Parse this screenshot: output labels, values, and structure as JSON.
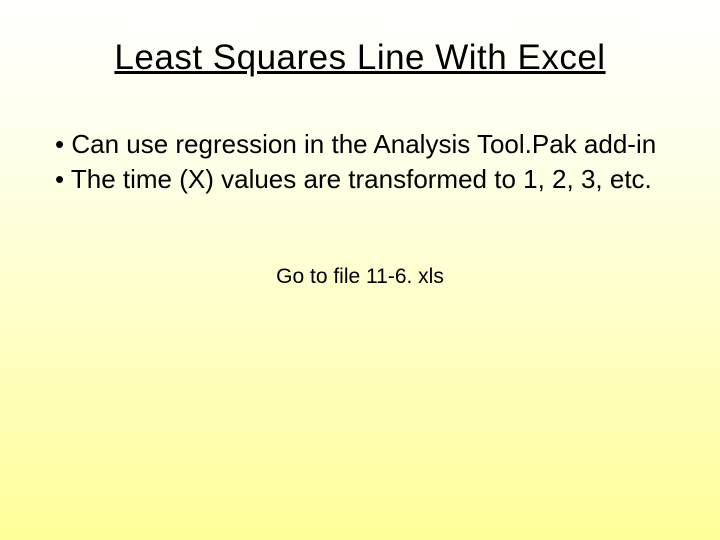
{
  "slide": {
    "title": "Least Squares Line With Excel",
    "bullets": [
      "Can use regression in the Analysis Tool.Pak add-in",
      "The time (X) values are transformed to 1, 2, 3, etc."
    ],
    "note": "Go to file 11-6. xls"
  }
}
